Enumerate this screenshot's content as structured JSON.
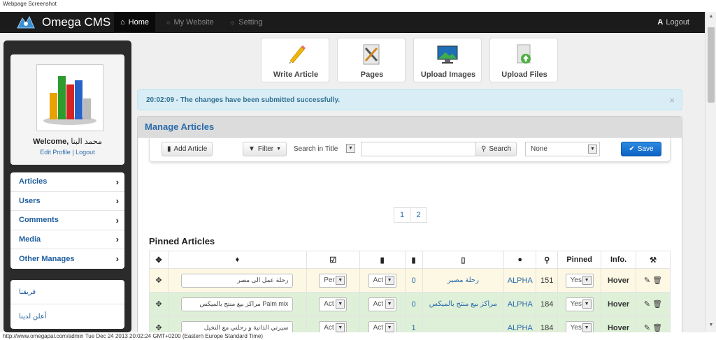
{
  "captions": {
    "top": "Webpage Screenshot",
    "bottom": "http://www.omegapal.com/admin Tue Dec 24 2013 20:02:24 GMT+0200 (Eastern Europe Standard Time)"
  },
  "navbar": {
    "brand": "Omega CMS",
    "items": [
      {
        "label": "Home",
        "icon": "home-icon"
      },
      {
        "label": "My Website",
        "icon": "globe-icon"
      },
      {
        "label": "Setting",
        "icon": "gear-icon"
      }
    ],
    "logout": "Logout"
  },
  "sidebar": {
    "welcome_label": "Welcome,",
    "user_name": "محمد البنا",
    "profile_links": "Edit Profile | Logout",
    "menu": [
      "Articles",
      "Users",
      "Comments",
      "Media",
      "Other Manages"
    ],
    "links": [
      "فريقنا",
      "أعلن لدينا"
    ]
  },
  "tiles": [
    "Write Article",
    "Pages",
    "Upload Images",
    "Upload Files"
  ],
  "alert": {
    "message": "20:02:09 - The changes have been submitted successfully.",
    "close": "×"
  },
  "panel": {
    "title": "Manage Articles",
    "toolbar": {
      "add": "Add Article",
      "filter": "Filter",
      "search_field": "Search in Title",
      "search": "Search",
      "category": "None",
      "save": "Save"
    },
    "pages": [
      "1",
      "2"
    ],
    "section_title": "Pinned Articles",
    "headers": {
      "pinned": "Pinned",
      "info": "Info."
    },
    "rows": [
      {
        "title": "رحلة عمل الى مصر",
        "status": "Per",
        "comments_mode": "Act",
        "comments": "0",
        "category": "رحلة مصير",
        "author": "ALPHA",
        "views": "151",
        "pinned": "Yes",
        "info": "Hover",
        "style": "yellow"
      },
      {
        "title": "مراكز بيع منتج بالميكس Palm mix",
        "status": "Act",
        "comments_mode": "Act",
        "comments": "0",
        "category": "مراكز بيع منتج بالميكس",
        "author": "ALPHA",
        "views": "184",
        "pinned": "Yes",
        "info": "Hover",
        "style": "green"
      },
      {
        "title": "سيرتي الذاتية و رحلتي مع النخيل",
        "status": "Act",
        "comments_mode": "Act",
        "comments": "1",
        "category": "",
        "author": "ALPHA",
        "views": "184",
        "pinned": "Yes",
        "info": "Hover",
        "style": "green"
      }
    ]
  }
}
